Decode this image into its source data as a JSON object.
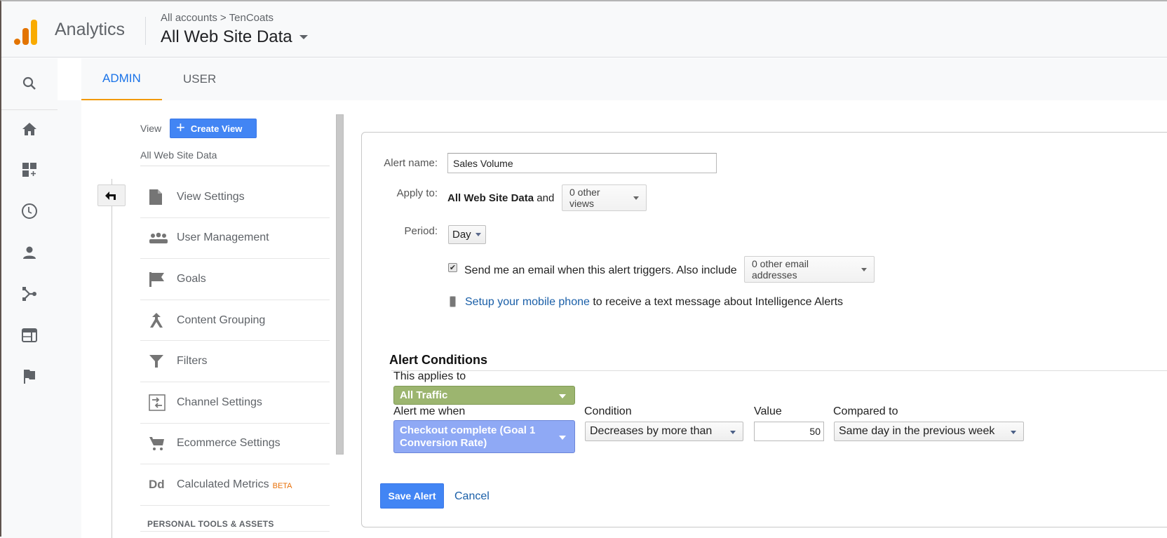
{
  "header": {
    "app_name": "Analytics",
    "breadcrumb": {
      "account": "All accounts",
      "separator": ">",
      "property": "TenCoats"
    },
    "view_title": "All Web Site Data",
    "brand_colors": {
      "logo_dark": "#e37400",
      "logo_light": "#f9ab00"
    }
  },
  "rail": {
    "icons": [
      "search-icon",
      "home-icon",
      "customization-icon",
      "realtime-clock-icon",
      "audience-person-icon",
      "acquisition-icon",
      "behavior-icon",
      "conversions-flag-icon"
    ]
  },
  "tabs": [
    {
      "label": "ADMIN",
      "active": true
    },
    {
      "label": "USER",
      "active": false
    }
  ],
  "admin_column": {
    "view_label": "View",
    "create_view_label": "Create View",
    "view_name": "All Web Site Data",
    "menu": [
      {
        "label": "View Settings",
        "icon": "document-icon"
      },
      {
        "label": "User Management",
        "icon": "people-icon"
      },
      {
        "label": "Goals",
        "icon": "flag-icon"
      },
      {
        "label": "Content Grouping",
        "icon": "content-grouping-icon"
      },
      {
        "label": "Filters",
        "icon": "filter-icon"
      },
      {
        "label": "Channel Settings",
        "icon": "channel-settings-icon"
      },
      {
        "label": "Ecommerce Settings",
        "icon": "cart-icon"
      },
      {
        "label": "Calculated Metrics",
        "icon": "dd-icon",
        "badge": "BETA"
      }
    ],
    "section_personal": "PERSONAL TOOLS & ASSETS"
  },
  "form": {
    "alert_name_label": "Alert name:",
    "alert_name_value": "Sales Volume",
    "apply_to_label": "Apply to:",
    "apply_to_view": "All Web Site Data",
    "apply_to_and": "and",
    "other_views": "0 other views",
    "period_label": "Period:",
    "period_value": "Day",
    "email_checked": true,
    "email_text": "Send me an email when this alert triggers. Also include",
    "other_emails": "0 other email addresses",
    "mobile_link": "Setup your mobile phone",
    "mobile_rest": "to receive a text message about Intelligence Alerts"
  },
  "conditions": {
    "title": "Alert Conditions",
    "applies_to_label": "This applies to",
    "applies_to_value": "All Traffic",
    "alert_when_label": "Alert me when",
    "alert_when_value": "Checkout complete (Goal 1 Conversion Rate)",
    "condition_label": "Condition",
    "condition_value": "Decreases by more than",
    "value_label": "Value",
    "value_value": "50",
    "compared_label": "Compared to",
    "compared_value": "Same day in the previous week",
    "colors": {
      "traffic": "#9cb56f",
      "metric": "#8fa9f5"
    }
  },
  "actions": {
    "save_label": "Save Alert",
    "cancel_label": "Cancel"
  }
}
